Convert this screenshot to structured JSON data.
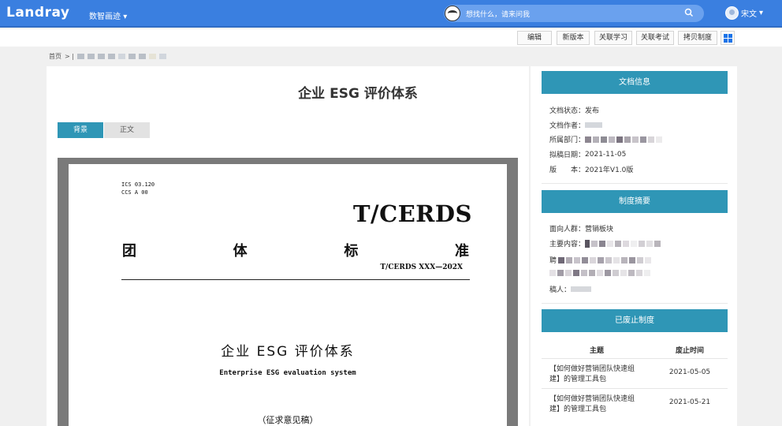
{
  "header": {
    "logo": "Landray",
    "nav_label": "数智画迹",
    "nav_caret": "▾",
    "search_placeholder": "想找什么，请来问我",
    "search_icon": "search-icon",
    "user_name": "宋文",
    "user_caret": "▾"
  },
  "toolbar": {
    "buttons": [
      "编辑",
      "新版本",
      "关联学习",
      "关联考试",
      "拷贝制度"
    ],
    "grid_icon": "grid-view-icon"
  },
  "breadcrumb": {
    "home": "首页",
    "separator": "> |"
  },
  "document": {
    "title": "企业 ESG 评价体系",
    "tabs": [
      "背景",
      "正文"
    ],
    "active_tab": "背景",
    "pdf": {
      "ics": "ICS 03.120",
      "ccs": "CCS A 00",
      "std_code": "T/CERDS",
      "std_type": [
        "团",
        "体",
        "标",
        "准"
      ],
      "std_number": "T/CERDS XXX—202X",
      "cn_title": "企业 ESG 评价体系",
      "en_title": "Enterprise ESG evaluation system",
      "draft_note": "（征求意见稿）"
    }
  },
  "sidebar": {
    "doc_info": {
      "heading": "文档信息",
      "status_label": "文档状态：",
      "status_value": "发布",
      "author_label": "文档作者：",
      "dept_label": "所属部门：",
      "date_label": "拟稿日期：",
      "date_value": "2021-11-05",
      "version_label": "版　　本：",
      "version_value": "2021年V1.0版"
    },
    "summary": {
      "heading": "制度摘要",
      "audience_label": "面向人群：",
      "audience_value": "营销板块",
      "content_label": "主要内容：",
      "line3_prefix": "聘",
      "reviewer_label": "稿人："
    },
    "abolished": {
      "heading": "已废止制度",
      "col_subject": "主题",
      "col_time": "废止时间",
      "rows": [
        {
          "subject": "【如何做好营销团队快速组建】的管理工具包",
          "time": "2021-05-05"
        },
        {
          "subject": "【如何做好营销团队快速组建】的管理工具包",
          "time": "2021-05-21"
        }
      ]
    }
  },
  "colors": {
    "header_bg": "#3a7fe0",
    "accent_teal": "#2f96b6",
    "grid_icon_blue": "#1a73e8"
  }
}
